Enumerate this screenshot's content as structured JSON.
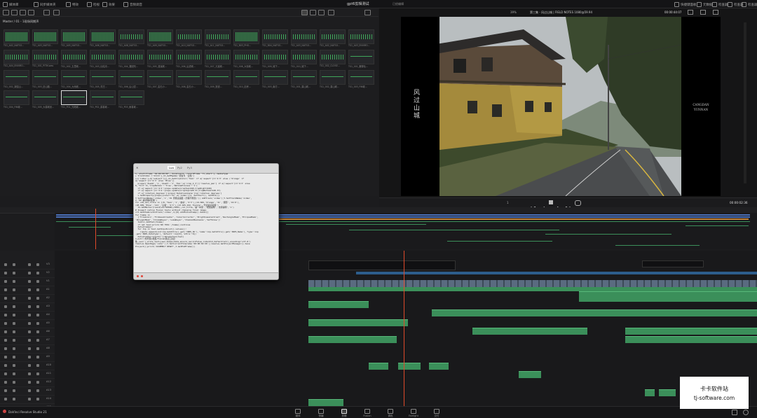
{
  "app": {
    "name": "DaVinci Resolve Studio 21",
    "project_title": "gpt6剪辑测试",
    "edit_status": "已经编辑"
  },
  "menu": {
    "left": [
      {
        "label": "媒体库",
        "icon": "media-pool-icon"
      },
      {
        "label": "同步媒体夹",
        "icon": "sync-bin-icon"
      },
      {
        "label": "特效",
        "icon": "effects-icon"
      },
      {
        "label": "检视",
        "icon": "inspector-icon"
      },
      {
        "label": "效果",
        "icon": "fx-icon"
      },
      {
        "label": "音频调音",
        "icon": "mixer-icon"
      }
    ],
    "right": [
      {
        "label": "快捷键面板",
        "icon": "keyboard-icon"
      },
      {
        "label": "元数据",
        "icon": "metadata-icon"
      },
      {
        "label": "检查器",
        "icon": "inspector-panel-icon"
      },
      {
        "label": "检查器",
        "icon": "inspector-icon"
      },
      {
        "label": "检查器",
        "icon": "inspector-icon"
      }
    ]
  },
  "breadcrumb": "Master / 01 - 1现场同期声",
  "viewer": {
    "timeline_name": "第三集 - 风过山城 | FIELD NOTES 1080@59.94",
    "zoom": "39%",
    "timecode": "00:00:44:07",
    "title_left": [
      "风",
      "过",
      "山",
      "城"
    ],
    "title_right": [
      "CANGDAN",
      "YUNNAN"
    ]
  },
  "transport": {
    "current_timecode": "00:00:02:36",
    "page_label": "1"
  },
  "clips": [
    {
      "name": "TS1_A02_NATSO...",
      "wave": "big"
    },
    {
      "name": "TS1_A03_NATSO...",
      "wave": "big"
    },
    {
      "name": "TS1_A05_NATSO...",
      "wave": "big"
    },
    {
      "name": "TS1_A06_NATSO...",
      "wave": "big"
    },
    {
      "name": "TS1_A08_NATSO...",
      "wave": "mid"
    },
    {
      "name": "TS1_A09_NATSO...",
      "wave": "big"
    },
    {
      "name": "TS1_A10_NATSO...",
      "wave": "mid"
    },
    {
      "name": "TS1_A11_NATSO...",
      "wave": "mid"
    },
    {
      "name": "TS1_B03_PHO...",
      "wave": "big"
    },
    {
      "name": "TS1_B04_NATSO...",
      "wave": "mid"
    },
    {
      "name": "TS1_A03_NATSO...",
      "wave": "mid"
    },
    {
      "name": "TS1_A02_NATSO...",
      "wave": "mid"
    },
    {
      "name": "TS1_A03_ENVIRO...",
      "wave": "mid"
    },
    {
      "name": "TS1_A04_ENVIRO...",
      "wave": "mid"
    },
    {
      "name": "TS1_001_PITM.wav",
      "wave": "mid"
    },
    {
      "name": "TS1_002_五里城...",
      "wave": "mid"
    },
    {
      "name": "TS1_003_仙姑沟...",
      "wave": "mid"
    },
    {
      "name": "TS1_004_凝固剂...",
      "wave": "mid"
    },
    {
      "name": "TS1_005_漫溪城...",
      "wave": "mid"
    },
    {
      "name": "TS1_006_后进城...",
      "wave": "mid"
    },
    {
      "name": "TS1_007_元宝城...",
      "wave": "mid"
    },
    {
      "name": "TS1_008_大街城...",
      "wave": "mid"
    },
    {
      "name": "TS1_009_城下...",
      "wave": "mid"
    },
    {
      "name": "TS1_010_城下...",
      "wave": "mid"
    },
    {
      "name": "TS1_002_CLOSE...",
      "wave": "mid"
    },
    {
      "name": "TS1_001_鹿寨仙...",
      "wave": "flat"
    },
    {
      "name": "TS1_002_潮湿山...",
      "wave": "flat"
    },
    {
      "name": "TS1_003_旧山路...",
      "wave": "flat"
    },
    {
      "name": "TS1_004_大雨城...",
      "wave": "flat"
    },
    {
      "name": "TS1_005_村庄...",
      "wave": "flat"
    },
    {
      "name": "TS1_006_后山堂...",
      "wave": "flat"
    },
    {
      "name": "TS1_007_岩石小...",
      "wave": "flat"
    },
    {
      "name": "TS1_008_岩石小...",
      "wave": "flat"
    },
    {
      "name": "TS1_009_铁道...",
      "wave": "flat"
    },
    {
      "name": "TS1_010_旧房...",
      "wave": "flat"
    },
    {
      "name": "TS1_003_南方...",
      "wave": "flat"
    },
    {
      "name": "TS1_001_暮山城...",
      "wave": "flat"
    },
    {
      "name": "TS1_002_暮山城...",
      "wave": "flat"
    },
    {
      "name": "TS1_003_FIN城...",
      "wave": "flat"
    },
    {
      "name": "TS1_004_FIN城...",
      "wave": "flat"
    },
    {
      "name": "TS1_005_大暮城景...",
      "wave": "flat"
    },
    {
      "name": "TS1_P01_光暗城...",
      "wave": "flat"
    },
    {
      "name": "TS1_P02_暮暮城...",
      "wave": "flat"
    },
    {
      "name": "TS1_P03_雨暮城...",
      "wave": "flat"
    }
  ],
  "tracks": {
    "video": [
      "V3",
      "V2",
      "V1"
    ],
    "audio": [
      "A1",
      "A2",
      "A3",
      "A4",
      "A5",
      "A6",
      "A7",
      "A8",
      "A9",
      "A10",
      "A11",
      "A12",
      "A13",
      "A14",
      "A15"
    ]
  },
  "console": {
    "tabs": [
      "Lua",
      "Py2",
      "Py3"
    ],
    "active_tab": "Lua",
    "lines": [
      "1, start=frame '02:09:00:00', duration=1, recordFrame 'Ti_start'}, mediaType",
      "+ trackIndex ='11111'},11,GetMgame('视台为 '白色'}",
      "[v['index']~4['subject']}},11,GetClipColor('Teal' if a['aspect']=='4:3' else ('Orange' if",
      "a['aspect']=='4:3' else 'Blue'))",
      "  props=['ZoomX','1','ZoomY':'1','Pan':a['crop_4_3']['resolve_pan'] if a['aspect']=='4:3' else",
      "0,'Tilt':0,'CropRetain':'True','RetimeProcess':'1']",
      "  if a['aspect']=='4:3':props.update(CropTop=240,CropRight=240)",
      "  if a['aspect']=='3:4':props.update(CropTop=128.37,CropBottom=128.37)",
      "  if a['rotation_degrees']:props['RotationAngle']=a['rotation_degrees']",
      "  v.SetProperty(props){color='V1',a['index']+1, GetStart(), GetEnd()}",
      "3 SetTrackName('video','1','01 原始主画面 (仍留不修改)')) AddTrack('video');t.SetTrackName('video',",
      "2,'02 裁切保护区域')",
      "for vdx,sel,title in [(0,'Teal','1','启动','4:3'),(12.666,'Orange','11','圆形','16:9'),",
      "(28.999,'Blue','121','山城','4:3'),(13.165,222,'Purple','代表最高标准')",
      "  t2.AddMarker(round(vdx*60000)/1001),col,title,'第一中英','视频说明','支持说明','1')",
      "# Inspect native Fusion tools without changing final image.",
      "c=t.GetItemListInTrack('video',1)[0].AddFusionComp().data=[]",
      "for tname in",
      "  ['TileGrain','FilmLookCreator','ColorCorrector','BrightnessContrast','RectangleMask','EllipseMask',",
      "'PolygonMask','ChromaKeyer','LumaKeyer','ChannelBooleans','SoftGlow']:",
      "  tool=c.AddTool(tname)",
      "  if not tool:print('NO TOOL',tname);continue",
      "  data[tname]=",
      "  for inp in tool.GetInputList().values():",
      "    inputs.append({id:inp.GetAttrs().get('INPS_ID'),'name':inp.GetAttrs().get('INPS_Name'),'type':inp",
      ".get('INPS_DataType'),'default':inp[0],'attrs':0})",
      "  data[tname]=inputs[:];DeleteTool(tool)",
      "1~out='/新代码/视频/Fusion测试工具表'",
      "数_json'),write_text(json.dumps(data,ensure_ascii=False,indent=2,default=str),encoding='utf-8')",
      "",
      "resolve.OpenPage('color');t.SetCurrentTimecode('00:00:02:26');resolve.GetProjectManager().Save",
      "Project();print('ASSEMBLY READY',t.GetEndFrame())"
    ]
  },
  "pages": [
    {
      "label": "媒体",
      "icon": "media-page-icon"
    },
    {
      "label": "快编",
      "icon": "cut-page-icon"
    },
    {
      "label": "剪辑",
      "icon": "edit-page-icon",
      "active": true
    },
    {
      "label": "Fusion",
      "icon": "fusion-page-icon"
    },
    {
      "label": "调色",
      "icon": "color-page-icon"
    },
    {
      "label": "Fairlight",
      "icon": "fairlight-page-icon"
    },
    {
      "label": "交付",
      "icon": "deliver-page-icon"
    }
  ],
  "watermark": {
    "title": "卡卡软件站",
    "url": "tj-software.com"
  }
}
